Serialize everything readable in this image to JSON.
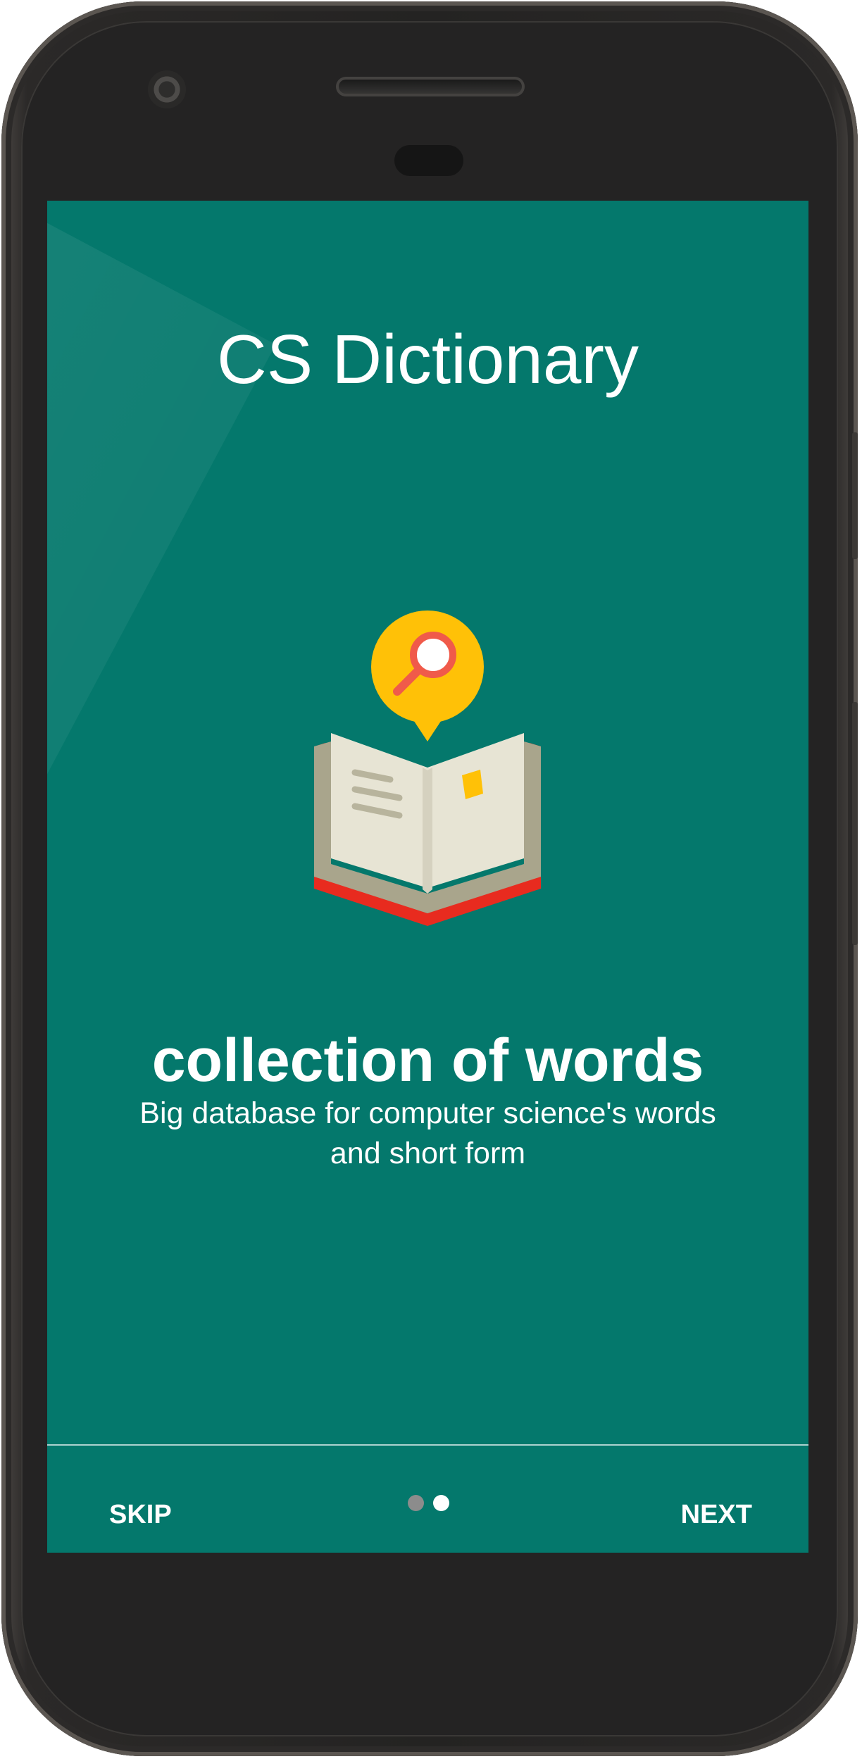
{
  "app": {
    "title": "CS Dictionary"
  },
  "onboarding": {
    "headline": "collection of words",
    "description": "Big database for computer science's words and short form",
    "current_page": 2,
    "total_pages": 2
  },
  "footer": {
    "skip_label": "SKIP",
    "next_label": "NEXT"
  },
  "icons": {
    "illustration": "book-with-search-icon",
    "search": "magnifying-glass-icon"
  },
  "colors": {
    "screen_background": "#04786c",
    "accent_yellow": "#ffc107",
    "book_red": "#e82b1f",
    "page_cream": "#e7e4d4"
  }
}
